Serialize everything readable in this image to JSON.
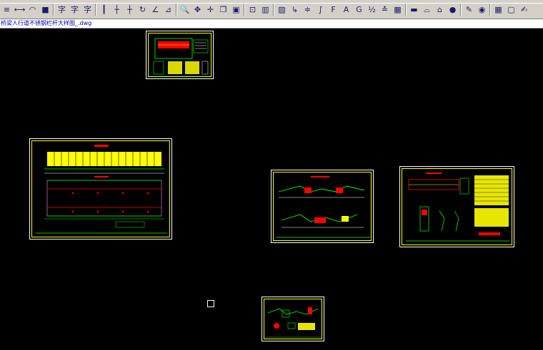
{
  "document": {
    "tab_title": "桥梁人行道不锈钢栏杆大样图_.dwg"
  },
  "toolbar": {
    "buttons": [
      {
        "name": "align-left-icon",
        "glyph": "≡"
      },
      {
        "name": "distance-icon",
        "glyph": "⟷"
      },
      {
        "name": "arc-length-icon",
        "glyph": "◠"
      },
      {
        "name": "stack-icon",
        "glyph": "■"
      },
      {
        "name": "dimension-linear-icon",
        "glyph": "字"
      },
      {
        "name": "text-style-icon",
        "glyph": "字"
      },
      {
        "name": "text-edit-icon",
        "glyph": "字"
      },
      {
        "name": "dim-continue-icon",
        "glyph": "┃"
      },
      {
        "name": "dim-baseline-icon",
        "glyph": "┼"
      },
      {
        "name": "dim-ordinate-icon",
        "glyph": "┼"
      },
      {
        "name": "rotate-icon",
        "glyph": "↻"
      },
      {
        "name": "dim-angle-icon",
        "glyph": "∠"
      },
      {
        "name": "dim-radius-icon",
        "glyph": "⊿"
      },
      {
        "name": "zoom-realtime-icon",
        "glyph": "🔍"
      },
      {
        "name": "pan-icon",
        "glyph": "✥"
      },
      {
        "name": "move-icon",
        "glyph": "✛"
      },
      {
        "name": "copy-icon",
        "glyph": "❐"
      },
      {
        "name": "block-icon",
        "glyph": "▣"
      },
      {
        "name": "window-icon",
        "glyph": "⊡"
      },
      {
        "name": "table-icon",
        "glyph": "▥"
      },
      {
        "name": "image-icon",
        "glyph": "▨"
      },
      {
        "name": "polyline-icon",
        "glyph": "↳"
      },
      {
        "name": "stair-icon",
        "glyph": "≑"
      },
      {
        "name": "curve-icon",
        "glyph": "∫"
      },
      {
        "name": "leader-icon",
        "glyph": "F"
      },
      {
        "name": "text-a-icon",
        "glyph": "A"
      },
      {
        "name": "text-g-icon",
        "glyph": "G"
      },
      {
        "name": "scale-100-icon",
        "glyph": "½"
      },
      {
        "name": "dim-style-icon",
        "glyph": "≛"
      },
      {
        "name": "grid-icon",
        "glyph": "▦"
      },
      {
        "name": "hatch-icon",
        "glyph": "▬"
      },
      {
        "name": "bridge-icon",
        "glyph": "⌓"
      },
      {
        "name": "building-icon",
        "glyph": "⌂"
      },
      {
        "name": "car-icon",
        "glyph": "●"
      },
      {
        "name": "pencil-icon",
        "glyph": "✎"
      },
      {
        "name": "eye-icon",
        "glyph": "◉"
      },
      {
        "name": "calculator-icon",
        "glyph": "▦"
      },
      {
        "name": "frame-icon",
        "glyph": "▢"
      },
      {
        "name": "brush-icon",
        "glyph": "✍"
      }
    ]
  },
  "colors": {
    "background": "#000000",
    "frame": "#ffffff",
    "border": "#ffff00",
    "green": "#00ff00",
    "red": "#ff0000",
    "cyan": "#00ffff",
    "magenta": "#ff00ff"
  }
}
